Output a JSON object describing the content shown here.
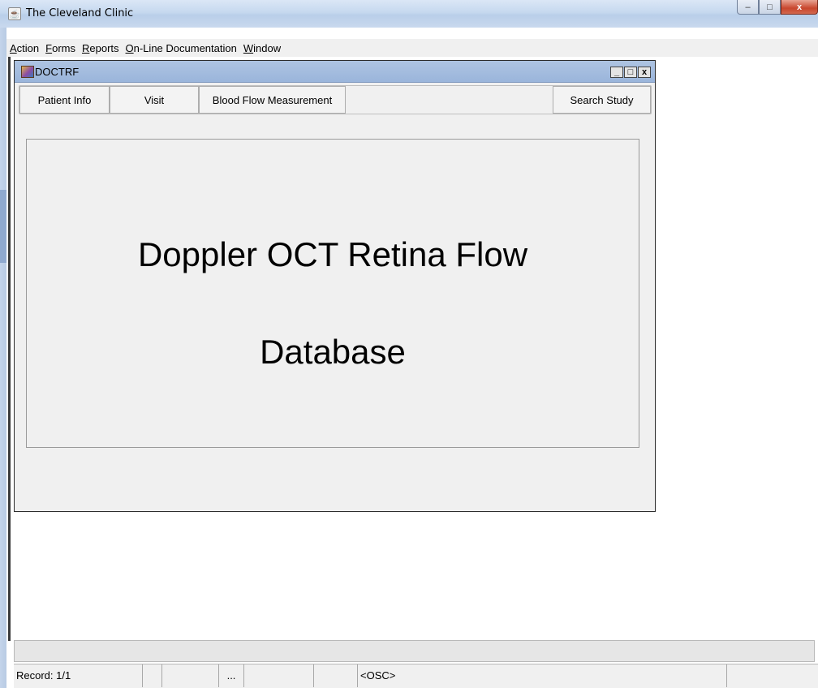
{
  "window": {
    "title": "The Cleveland Clinic",
    "controls": {
      "minimize": "–",
      "maximize": "□",
      "close": "x"
    }
  },
  "menubar": {
    "items": [
      {
        "prefix": "",
        "ul": "A",
        "rest": "ction"
      },
      {
        "prefix": "",
        "ul": "F",
        "rest": "orms"
      },
      {
        "prefix": "",
        "ul": "R",
        "rest": "eports"
      },
      {
        "prefix": "",
        "ul": "O",
        "rest": "n-Line Documentation"
      },
      {
        "prefix": "",
        "ul": "W",
        "rest": "indow"
      }
    ]
  },
  "internal_frame": {
    "title": "DOCTRF",
    "controls": {
      "minimize": "_",
      "maximize": "□",
      "close": "x"
    },
    "buttons": {
      "patient_info": "Patient Info",
      "visit": "Visit",
      "blood_flow": "Blood Flow Measurement",
      "search_study": "Search Study"
    },
    "heading_line1": "Doppler OCT Retina Flow",
    "heading_line2": "Database"
  },
  "statusbar": {
    "record": "Record: 1/1",
    "cell2": "",
    "cell3": "",
    "ellipsis": "...",
    "cell5": "",
    "cell6": "",
    "mode": "<OSC>",
    "cell8": ""
  }
}
